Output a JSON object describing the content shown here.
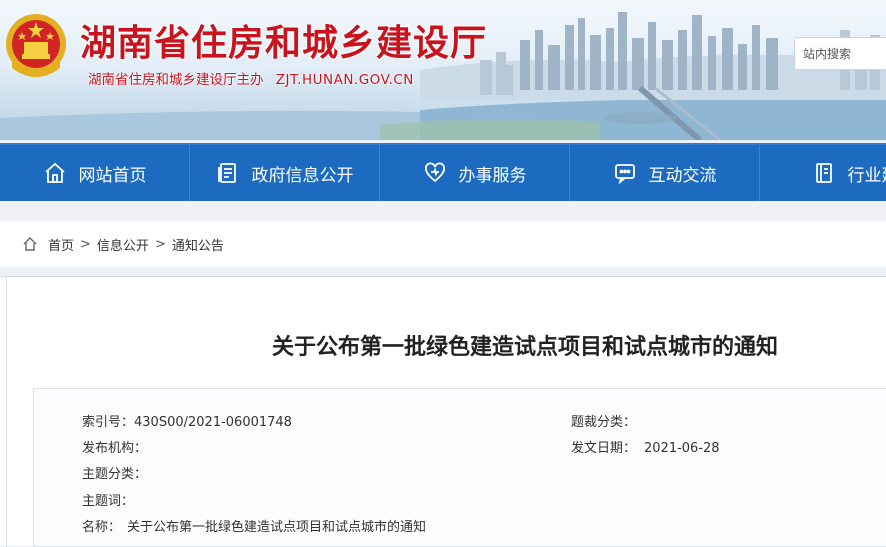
{
  "header": {
    "title": "湖南省住房和城乡建设厅",
    "subtitle": "湖南省住房和城乡建设厅主办",
    "domain": "ZJT.HUNAN.GOV.CN",
    "search_placeholder": "站内搜索"
  },
  "nav": {
    "items": [
      {
        "label": "网站首页",
        "icon": "home-icon"
      },
      {
        "label": "政府信息公开",
        "icon": "document-icon"
      },
      {
        "label": "办事服务",
        "icon": "heart-icon"
      },
      {
        "label": "互动交流",
        "icon": "chat-icon"
      },
      {
        "label": "行业建",
        "icon": "book-icon"
      }
    ]
  },
  "breadcrumb": {
    "items": [
      "首页",
      "信息公开",
      "通知公告"
    ],
    "separator": ">"
  },
  "article": {
    "title": "关于公布第一批绿色建造试点项目和试点城市的通知",
    "meta": {
      "index_label": "索引号：",
      "index_value": "430S00/2021-06001748",
      "category_label": "题裁分类：",
      "category_value": "",
      "org_label": "发布机构：",
      "org_value": "",
      "date_label": "发文日期：",
      "date_value": "2021-06-28",
      "topic_label": "主题分类：",
      "topic_value": "",
      "keywords_label": "主题词：",
      "keywords_value": "",
      "name_label": "名称：",
      "name_value": "关于公布第一批绿色建造试点项目和试点城市的通知"
    }
  },
  "colors": {
    "brand_red": "#c8141e",
    "nav_blue": "#1d6bc0",
    "page_bg": "#eef1f5"
  }
}
